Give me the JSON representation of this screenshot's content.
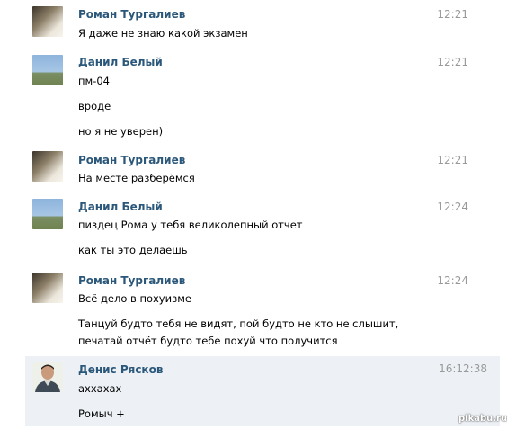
{
  "messages": [
    {
      "author": "Роман Тургалиев",
      "time": "12:21",
      "avatar": "roman-avatar",
      "lines": [
        "Я даже не знаю какой экзамен"
      ]
    },
    {
      "author": "Данил Белый",
      "time": "12:21",
      "avatar": "danil-avatar",
      "lines": [
        "пм-04",
        "вроде",
        "но я не уверен)"
      ]
    },
    {
      "author": "Роман Тургалиев",
      "time": "12:21",
      "avatar": "roman-avatar",
      "lines": [
        "На месте разберёмся"
      ]
    },
    {
      "author": "Данил Белый",
      "time": "12:24",
      "avatar": "danil-avatar",
      "lines": [
        "пиздец Рома у тебя великолепный отчет",
        "как ты это делаешь"
      ]
    },
    {
      "author": "Роман Тургалиев",
      "time": "12:24",
      "avatar": "roman-avatar",
      "lines": [
        "Всё дело в похуизме",
        "Танцуй будто тебя не видят, пой будто не кто не слышит,",
        "печатай отчёт будто тебе похуй что получится"
      ]
    },
    {
      "author": "Денис Рясков",
      "time": "16:12:38",
      "avatar": "denis-avatar",
      "lines": [
        "аххахах",
        "Ромыч +"
      ]
    }
  ],
  "watermark": "pikabu.ru",
  "colors": {
    "author": "#2b587a",
    "time": "#999999",
    "highlight": "#edf1f5"
  }
}
